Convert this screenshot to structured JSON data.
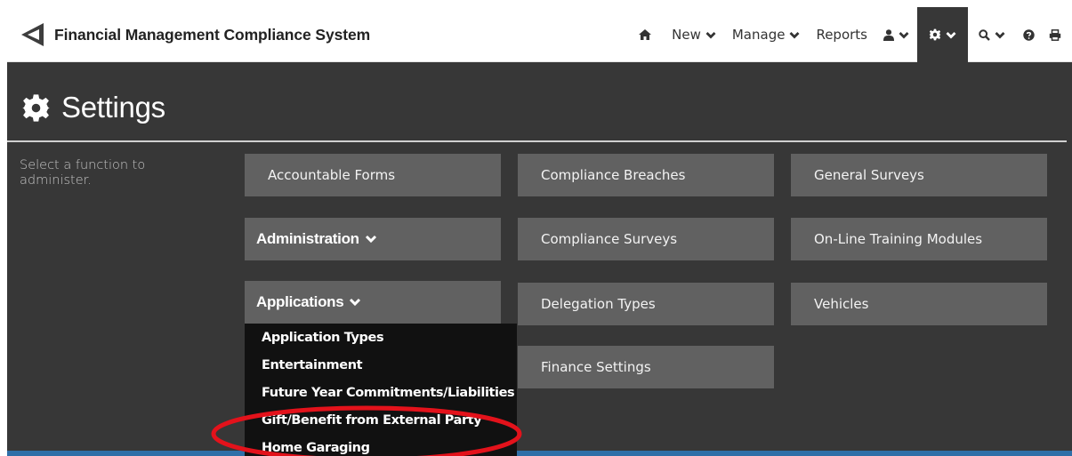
{
  "app": {
    "title": "Financial Management Compliance System"
  },
  "nav": {
    "new_label": "New",
    "manage_label": "Manage",
    "reports_label": "Reports"
  },
  "page": {
    "title": "Settings",
    "hint": "Select a function to administer."
  },
  "tiles": {
    "accountable_forms": "Accountable Forms",
    "administration": "Administration",
    "applications": "Applications",
    "compliance_breaches": "Compliance Breaches",
    "compliance_surveys": "Compliance Surveys",
    "delegation_types": "Delegation Types",
    "finance_settings": "Finance Settings",
    "general_surveys": "General Surveys",
    "online_training": "On-Line Training Modules",
    "vehicles": "Vehicles"
  },
  "dropdown": {
    "items": [
      "Application Types",
      "Entertainment",
      "Future Year Commitments/Liabilities",
      "Gift/Benefit from External Party",
      "Home Garaging"
    ]
  },
  "icons": {
    "brand": "megaphone-logo-icon",
    "home": "home-icon",
    "user": "user-icon",
    "settings": "cog-icon",
    "search": "search-icon",
    "help": "help-icon",
    "print": "print-icon"
  },
  "colors": {
    "content_bg": "#373737",
    "tile_bg": "#616161",
    "dropdown_bg": "#111111",
    "highlight": "#e3121b",
    "bottom_bar": "#2f6fa8"
  }
}
